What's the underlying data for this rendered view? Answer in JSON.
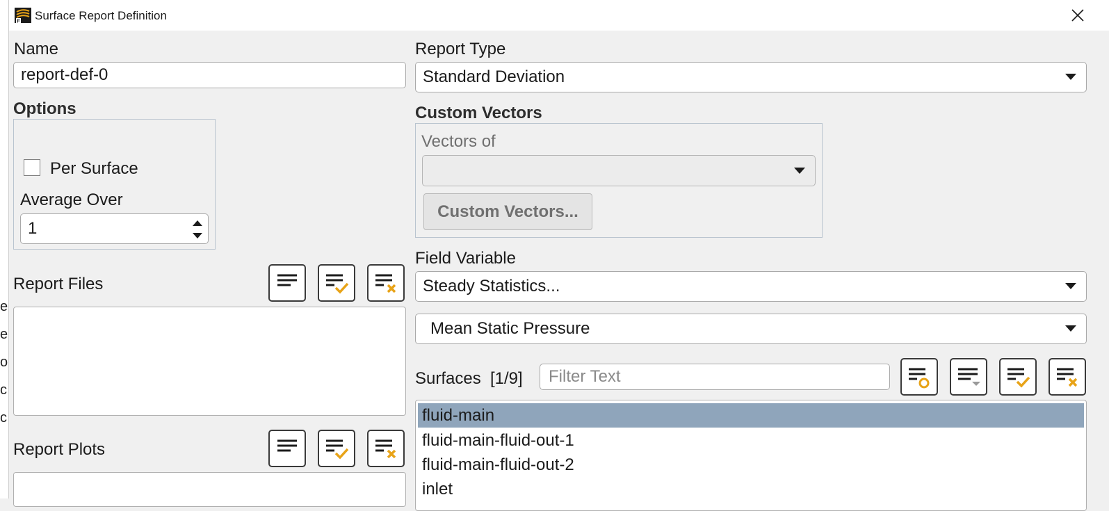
{
  "background_window": {
    "edge_letters": [
      "e",
      "e",
      "o",
      "c",
      "c"
    ]
  },
  "window": {
    "title": "Surface Report Definition",
    "close_icon": "close-icon",
    "app_icon": "fluent-app-icon"
  },
  "name": {
    "label": "Name",
    "value": "report-def-0"
  },
  "options": {
    "label": "Options",
    "per_surface_label": "Per Surface",
    "per_surface_checked": false,
    "average_over_label": "Average Over",
    "average_over_value": "1"
  },
  "report_files": {
    "label": "Report Files",
    "buttons": [
      "list-toggle-icon",
      "select-all-icon",
      "deselect-all-icon"
    ],
    "items": []
  },
  "report_plots": {
    "label": "Report Plots",
    "buttons": [
      "list-toggle-icon",
      "select-all-icon",
      "deselect-all-icon"
    ],
    "items": []
  },
  "report_type": {
    "label": "Report Type",
    "value": "Standard Deviation"
  },
  "custom_vectors": {
    "label": "Custom Vectors",
    "vectors_of_label": "Vectors of",
    "vectors_of_value": "",
    "button_label": "Custom Vectors..."
  },
  "field_variable": {
    "label": "Field Variable",
    "category": "Steady Statistics...",
    "variable": "Mean Static Pressure"
  },
  "surfaces": {
    "label": "Surfaces",
    "count": "[1/9]",
    "filter_placeholder": "Filter Text",
    "buttons": [
      "select-by-type-icon",
      "group-dropdown-icon",
      "select-all-icon",
      "deselect-all-icon"
    ],
    "items": [
      {
        "label": "fluid-main",
        "selected": true
      },
      {
        "label": "fluid-main-fluid-out-1",
        "selected": false
      },
      {
        "label": "fluid-main-fluid-out-2",
        "selected": false
      },
      {
        "label": "inlet",
        "selected": false
      }
    ]
  },
  "colors": {
    "selection": "#8fa5bb",
    "accent_orange": "#e8a317",
    "icon_dark": "#1b1b1b"
  }
}
